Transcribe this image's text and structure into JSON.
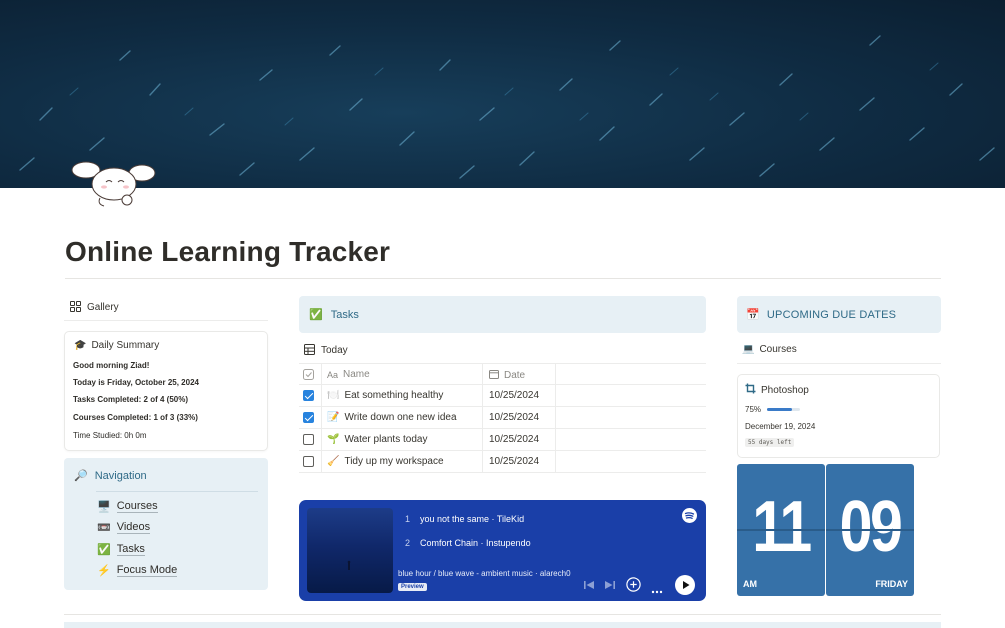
{
  "page": {
    "title": "Online Learning Tracker"
  },
  "colors": {
    "accent_box": "#e7f0f5",
    "accent_text": "#2f6a87",
    "player_bg": "#1a3fa8",
    "clock_bg": "#3671a8",
    "checkbox_blue": "#2783de"
  },
  "gallery": {
    "label": "Gallery",
    "icon": "gallery-grid-icon"
  },
  "summary": {
    "title": "Daily Summary",
    "icon": "graduation-cap-icon",
    "greeting": "Good morning Ziad!",
    "today": "Today is Friday, October 25, 2024",
    "tasks_completed": "Tasks Completed: 2 of 4 (50%)",
    "courses_completed": "Courses Completed: 1 of 3 (33%)",
    "time_studied": "Time Studied: 0h 0m"
  },
  "navigation": {
    "title": "Navigation",
    "icon": "magnifier-icon",
    "items": [
      {
        "label": "Courses",
        "icon": "desktop-computer-icon"
      },
      {
        "label": "Videos",
        "icon": "videotape-icon"
      },
      {
        "label": "Tasks",
        "icon": "check-mark-button-icon"
      },
      {
        "label": "Focus Mode",
        "icon": "lightning-icon"
      }
    ]
  },
  "tasks": {
    "title": "Tasks",
    "icon": "check-mark-button-icon",
    "view_label": "Today",
    "columns": {
      "name": "Name",
      "date": "Date"
    },
    "rows": [
      {
        "checked": true,
        "name": "Eat something healthy",
        "icon": "plate-icon",
        "date": "10/25/2024"
      },
      {
        "checked": true,
        "name": "Write down one new idea",
        "icon": "memo-icon",
        "date": "10/25/2024"
      },
      {
        "checked": false,
        "name": "Water plants today",
        "icon": "seedling-icon",
        "date": "10/25/2024"
      },
      {
        "checked": false,
        "name": "Tidy up my workspace",
        "icon": "broom-icon",
        "date": "10/25/2024"
      }
    ]
  },
  "player": {
    "tracks": [
      {
        "num": "1",
        "title": "you not the same · TileKid"
      },
      {
        "num": "2",
        "title": "Comfort Chain · Instupendo"
      }
    ],
    "album": "blue hour / blue wave - ambient music · alarech0",
    "badge": "Preview"
  },
  "due_dates": {
    "title": "UPCOMING DUE DATES",
    "icon": "calendar-icon",
    "view_label": "Courses",
    "view_icon": "laptop-icon",
    "course": {
      "name": "Photoshop",
      "icon": "crop-icon",
      "progress_label": "75%",
      "progress": 0.75,
      "due": "December 19, 2024",
      "days_left": "55 days left"
    }
  },
  "clock": {
    "hour": "11",
    "minute": "09",
    "ampm": "AM",
    "day": "FRIDAY"
  }
}
